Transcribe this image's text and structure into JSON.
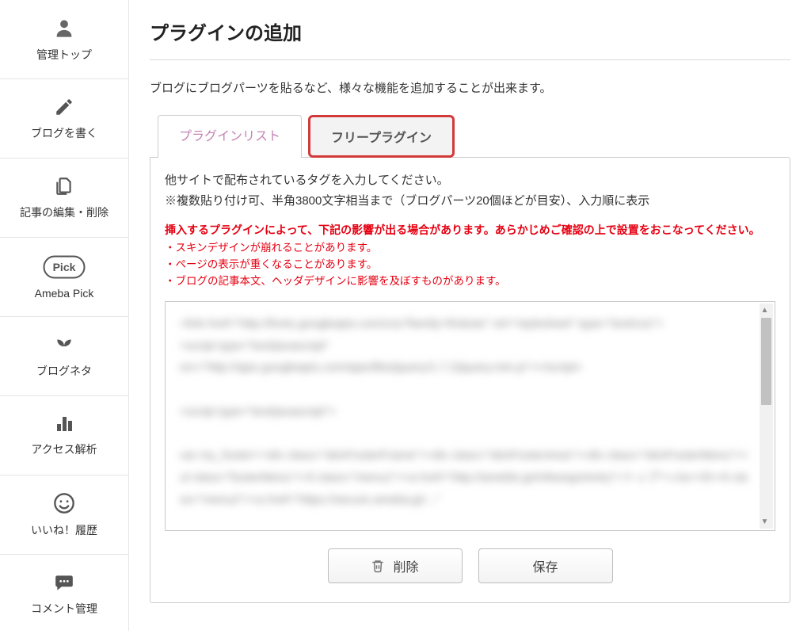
{
  "sidebar": {
    "items": [
      {
        "label": "管理トップ",
        "icon": "person-icon"
      },
      {
        "label": "ブログを書く",
        "icon": "pencil-icon"
      },
      {
        "label": "記事の編集・削除",
        "icon": "files-icon"
      },
      {
        "label": "Ameba Pick",
        "icon": "pick-icon"
      },
      {
        "label": "ブログネタ",
        "icon": "sprout-icon"
      },
      {
        "label": "アクセス解析",
        "icon": "bars-icon"
      },
      {
        "label": "いいね！履歴",
        "icon": "smile-icon"
      },
      {
        "label": "コメント管理",
        "icon": "chat-icon"
      }
    ]
  },
  "page": {
    "title": "プラグインの追加",
    "description": "ブログにブログパーツを貼るなど、様々な機能を追加することが出来ます。"
  },
  "tabs": {
    "list_label": "プラグインリスト",
    "free_label": "フリープラグイン"
  },
  "panel": {
    "instruction_line1": "他サイトで配布されているタグを入力してください。",
    "instruction_line2": "※複数貼り付け可、半角3800文字相当まで（ブログパーツ20個ほどが目安）、入力順に表示",
    "warning_head": "挿入するプラグインによって、下記の影響が出る場合があります。あらかじめご確認の上で設置をおこなってください。",
    "warning_item1": "・スキンデザインが崩れることがあります。",
    "warning_item2": "・ページの表示が重くなることがあります。",
    "warning_item3": "・ブログの記事本文、ヘッダデザインに影響を及ぼすものがあります。",
    "textarea_placeholder_blurred": "<link href=\"http://fonts.googleapis.com/css?family=Roboto\" rel=\"stylesheet\" type=\"text/css\">\n<script type=\"text/javascript\"\nsrc=\"http://ajax.googleapis.com/ajax/libs/jquery/1.7.2/jquery.min.js\"></script>\n\n<script type=\"text/javascript\">\n\nvar my_footer='<div class=\"skinFooterFrame\"><div class=\"skinFooterArea\"><div class=\"skinFooterMenu\"><ul class=\"footerMenu\"><li class=\"menu1\"><a href=\"http://ameblo.jp/mfeeego/entry\">トップへ</a></li><li class=\"menu2\"><a href=\"https://secure.ameba.jp/...\"",
    "delete_label": "削除",
    "save_label": "保存"
  }
}
